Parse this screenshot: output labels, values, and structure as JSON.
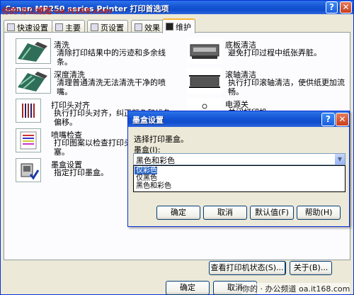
{
  "watermark": {
    "top": "你的·办公频道 oa.it168.com",
    "bottom": "你的 · 办公频道  oa.it168.com"
  },
  "window": {
    "title": "Canon MP250 series Printer 打印首选项"
  },
  "tabs": [
    {
      "label": "快速设置",
      "icon": "quick-setup-icon"
    },
    {
      "label": "主要",
      "icon": "main-icon"
    },
    {
      "label": "页设置",
      "icon": "page-setup-icon"
    },
    {
      "label": "效果",
      "icon": "effects-icon"
    },
    {
      "label": "维护",
      "icon": "maintenance-icon",
      "active": true
    }
  ],
  "maintenance": {
    "left": [
      {
        "name": "清洗",
        "desc": "清除打印结果中的污迹和多余线条。",
        "icon": "cleaning-icon"
      },
      {
        "name": "深度清洗",
        "desc": "清理普通清洗无法清洗干净的喷嘴。",
        "icon": "deep-cleaning-icon"
      },
      {
        "name": "打印头对齐",
        "desc": "执行打印头对齐，纠正颜色和线条偏移。",
        "icon": "print-head-alignment-icon"
      },
      {
        "name": "喷嘴检查",
        "desc": "打印图案以检查打印头喷嘴是否堵塞。",
        "icon": "nozzle-check-icon"
      },
      {
        "name": "墨盒设置",
        "desc": "指定打印墨盒。",
        "icon": "ink-cartridge-icon"
      }
    ],
    "right": [
      {
        "name": "底板清洁",
        "desc": "避免打印过程中纸张弄脏。",
        "icon": "bottom-plate-cleaning-icon"
      },
      {
        "name": "滚轴清洁",
        "desc": "执行打印滚轴清洁，使供纸更加流畅。",
        "icon": "roller-cleaning-icon"
      },
      {
        "name": "电源关",
        "desc": "关闭打印机。",
        "icon": "power-off-icon"
      }
    ]
  },
  "panel_buttons": {
    "status": "查看打印机状态(S)...",
    "about": "关于(B)..."
  },
  "footer_buttons": {
    "ok": "确定",
    "cancel": "取消"
  },
  "dialog": {
    "title": "墨盒设置",
    "instruction": "选择打印墨盒。",
    "field_label": "墨盒(I):",
    "selected": "黑色和彩色",
    "options": [
      "仅彩色",
      "仅黑色",
      "黑色和彩色"
    ],
    "buttons": {
      "ok": "确定",
      "cancel": "取消",
      "defaults": "默认值(F)",
      "help": "帮助(H)"
    }
  }
}
